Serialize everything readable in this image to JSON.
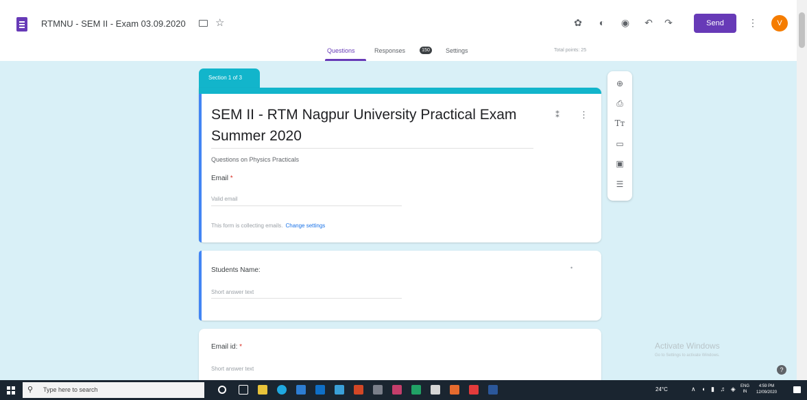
{
  "header": {
    "doc_title": "RTMNU - SEM II - Exam 03.09.2020",
    "send_label": "Send",
    "avatar_initial": "V",
    "icons": [
      "customize-theme-icon",
      "palette-icon",
      "preview-eye-icon",
      "undo-icon",
      "redo-icon"
    ]
  },
  "tabs": {
    "questions": "Questions",
    "responses": "Responses",
    "responses_count": "150",
    "settings": "Settings",
    "total_points": "Total points: 25"
  },
  "section": {
    "label": "Section 1 of 3"
  },
  "form": {
    "title": "SEM II - RTM Nagpur University Practical Exam Summer 2020",
    "description": "Questions on Physics Practicals",
    "email_label": "Email",
    "email_placeholder": "Valid email",
    "collect_note": "This form is collecting emails.",
    "change_settings": "Change settings"
  },
  "questions": [
    {
      "label": "Students Name:",
      "placeholder": "Short answer text"
    },
    {
      "label": "Email id:",
      "placeholder": "Short answer text"
    }
  ],
  "floating_toolbar": [
    "add-question-icon",
    "import-questions-icon",
    "add-title-icon",
    "add-image-icon",
    "add-video-icon",
    "add-section-icon"
  ],
  "watermark": {
    "title": "Activate Windows",
    "subtitle": "Go to Settings to activate Windows."
  },
  "taskbar": {
    "search_placeholder": "Type here to search",
    "weather": "24°C",
    "language": "ENG",
    "language_sub": "IN",
    "time": "4:59 PM",
    "date": "12/09/2020"
  },
  "colors": {
    "brand_purple": "#673ab7",
    "section_teal": "#12b5cb",
    "canvas_bg": "#d9f0f7",
    "focus_blue": "#4285f4"
  }
}
